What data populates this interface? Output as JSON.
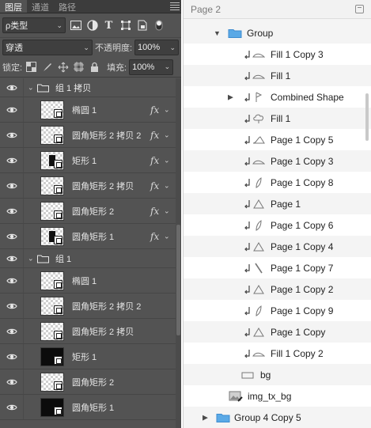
{
  "ps": {
    "tabs": [
      "图层",
      "通道",
      "路径"
    ],
    "filter": {
      "label": "ρ类型"
    },
    "blend_mode": "穿透",
    "opacity_label": "不透明度:",
    "opacity_value": "100%",
    "lock_label": "锁定:",
    "fill_label": "填充:",
    "fill_value": "100%",
    "layers": [
      {
        "kind": "group",
        "name": "组 1 拷贝"
      },
      {
        "kind": "layer",
        "name": "椭圆 1",
        "thumb": "checker",
        "fx": true
      },
      {
        "kind": "layer",
        "name": "圆角矩形 2 拷贝 2",
        "thumb": "checker",
        "fx": true
      },
      {
        "kind": "layer",
        "name": "矩形 1",
        "thumb": "checker-fill",
        "fx": true
      },
      {
        "kind": "layer",
        "name": "圆角矩形 2 拷贝",
        "thumb": "checker",
        "fx": true
      },
      {
        "kind": "layer",
        "name": "圆角矩形 2",
        "thumb": "checker",
        "fx": true
      },
      {
        "kind": "layer",
        "name": "圆角矩形 1",
        "thumb": "checker-fill",
        "fx": true
      },
      {
        "kind": "group",
        "name": "组 1"
      },
      {
        "kind": "layer",
        "name": "椭圆 1",
        "thumb": "checker",
        "fx": false
      },
      {
        "kind": "layer",
        "name": "圆角矩形 2 拷贝 2",
        "thumb": "checker",
        "fx": false
      },
      {
        "kind": "layer",
        "name": "圆角矩形 2 拷贝",
        "thumb": "checker",
        "fx": false
      },
      {
        "kind": "layer",
        "name": "矩形 1",
        "thumb": "black",
        "fx": false
      },
      {
        "kind": "layer",
        "name": "圆角矩形 2",
        "thumb": "checker",
        "fx": false
      },
      {
        "kind": "layer",
        "name": "圆角矩形 1",
        "thumb": "black",
        "fx": false
      }
    ],
    "fx_label": "fx"
  },
  "sk": {
    "page_title": "Page 2",
    "rows": [
      {
        "label": "Group",
        "type": "group-open",
        "indent": 0
      },
      {
        "label": "Fill 1 Copy 3",
        "type": "shape",
        "icon": "flat"
      },
      {
        "label": "Fill 1",
        "type": "shape",
        "icon": "flat"
      },
      {
        "label": "Combined Shape",
        "type": "combined",
        "icon": "flag"
      },
      {
        "label": "Fill 1",
        "type": "shape",
        "icon": "cloud"
      },
      {
        "label": "Page 1 Copy 5",
        "type": "shape",
        "icon": "slope"
      },
      {
        "label": "Page 1 Copy 3",
        "type": "shape",
        "icon": "flat"
      },
      {
        "label": "Page 1 Copy 8",
        "type": "shape",
        "icon": "leaf"
      },
      {
        "label": "Page 1",
        "type": "shape",
        "icon": "triangle"
      },
      {
        "label": "Page 1 Copy 6",
        "type": "shape",
        "icon": "leaf"
      },
      {
        "label": "Page 1 Copy 4",
        "type": "shape",
        "icon": "triangle"
      },
      {
        "label": "Page 1 Copy 7",
        "type": "shape",
        "icon": "slash"
      },
      {
        "label": "Page 1 Copy 2",
        "type": "shape",
        "icon": "triangle"
      },
      {
        "label": "Page 1 Copy 9",
        "type": "shape",
        "icon": "leaf"
      },
      {
        "label": "Page 1 Copy",
        "type": "shape",
        "icon": "triangle"
      },
      {
        "label": "Fill 1 Copy 2",
        "type": "shape",
        "icon": "flat"
      },
      {
        "label": "bg",
        "type": "rect"
      },
      {
        "label": "img_tx_bg",
        "type": "image"
      },
      {
        "label": "Group 4 Copy 5",
        "type": "group-closed"
      }
    ]
  }
}
